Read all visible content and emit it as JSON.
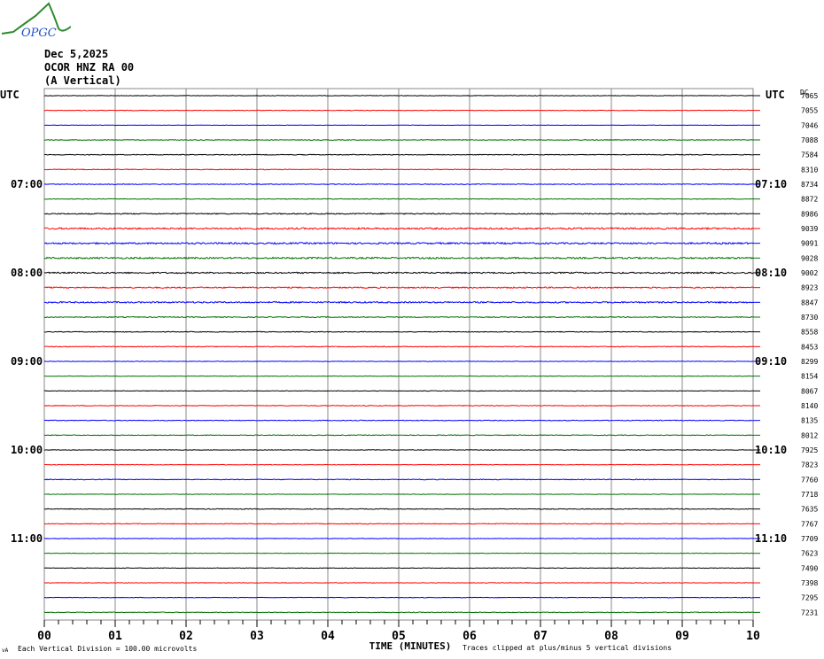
{
  "header": {
    "logo_text": "OPGC",
    "date": "Dec 5,2025",
    "station": "OCOR HNZ RA 00",
    "component": "(A Vertical)"
  },
  "chart_data": {
    "type": "line",
    "title": "OCOR HNZ RA 00 helicorder",
    "xlabel": "TIME (MINUTES)",
    "x_ticks": [
      "00",
      "01",
      "02",
      "03",
      "04",
      "05",
      "06",
      "07",
      "08",
      "09",
      "10"
    ],
    "xlim": [
      0,
      10
    ],
    "left_axis_title": "UTC",
    "right_axis_title": "UTC",
    "dc_title": "DC",
    "trace_colors": [
      "#000000",
      "#ff0000",
      "#0000ff",
      "#007000"
    ],
    "left_labels": [
      {
        "row": 6,
        "label": "07:00"
      },
      {
        "row": 12,
        "label": "08:00"
      },
      {
        "row": 18,
        "label": "09:00"
      },
      {
        "row": 24,
        "label": "10:00"
      },
      {
        "row": 30,
        "label": "11:00"
      }
    ],
    "right_labels": [
      {
        "row": 6,
        "label": "07:10"
      },
      {
        "row": 12,
        "label": "08:10"
      },
      {
        "row": 18,
        "label": "09:10"
      },
      {
        "row": 24,
        "label": "10:10"
      },
      {
        "row": 30,
        "label": "11:10"
      }
    ],
    "dc_offsets": [
      "7065",
      "7055",
      "7046",
      "7088",
      "7584",
      "8310",
      "8734",
      "8872",
      "8986",
      "9039",
      "9091",
      "9028",
      "9002",
      "8923",
      "8847",
      "8730",
      "8558",
      "8453",
      "8299",
      "8154",
      "8067",
      "8140",
      "8135",
      "8012",
      "7925",
      "7823",
      "7760",
      "7718",
      "7635",
      "7767",
      "7709",
      "7623",
      "7490",
      "7398",
      "7295",
      "7231"
    ],
    "noise_level": [
      0.3,
      0.3,
      0.2,
      0.4,
      0.4,
      0.4,
      0.4,
      0.4,
      0.6,
      0.9,
      0.9,
      0.9,
      0.8,
      0.7,
      0.8,
      0.5,
      0.4,
      0.4,
      0.3,
      0.3,
      0.3,
      0.4,
      0.4,
      0.4,
      0.3,
      0.3,
      0.4,
      0.3,
      0.4,
      0.4,
      0.3,
      0.3,
      0.3,
      0.3,
      0.3,
      0.4
    ],
    "footer_left": "Each Vertical Division =  100.00 microvolts",
    "footer_right": "Traces clipped at plus/minus 5 vertical divisions",
    "corner_mark": "vA"
  }
}
